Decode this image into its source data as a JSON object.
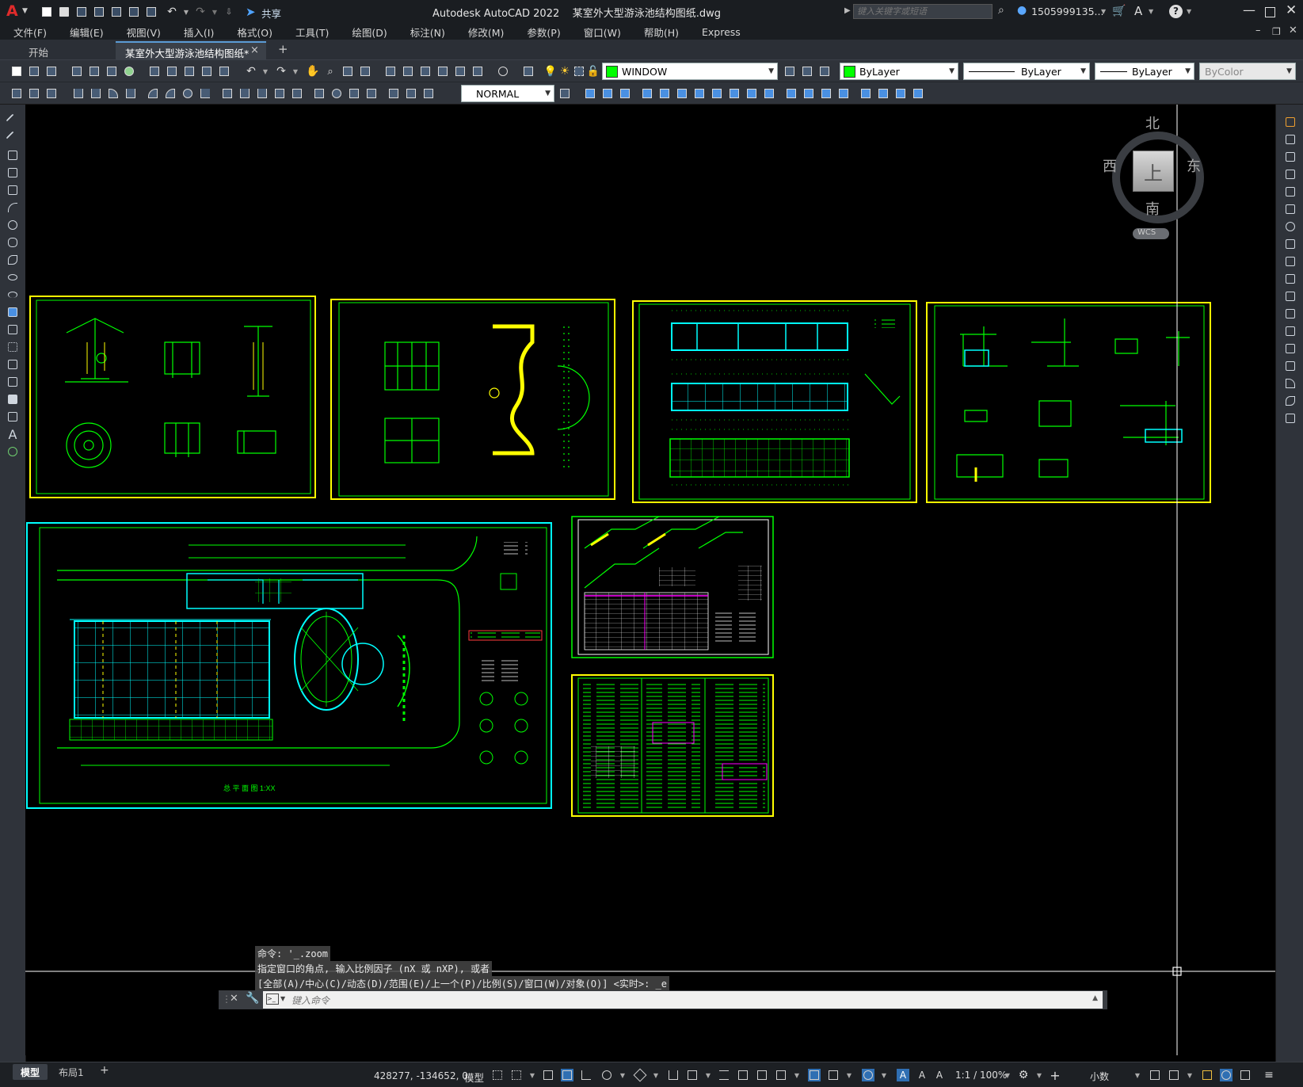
{
  "title": {
    "app_logo": "A",
    "share_label": "共享",
    "window_title": "Autodesk AutoCAD 2022    某室外大型游泳池结构图纸.dwg",
    "search_placeholder": "键入关键字或短语",
    "user": "1505999135...",
    "help": "?"
  },
  "menu": [
    "文件(F)",
    "编辑(E)",
    "视图(V)",
    "插入(I)",
    "格式(O)",
    "工具(T)",
    "绘图(D)",
    "标注(N)",
    "修改(M)",
    "参数(P)",
    "窗口(W)",
    "帮助(H)",
    "Express"
  ],
  "tabs": {
    "start": "开始",
    "active": "某室外大型游泳池结构图纸*",
    "close": "×",
    "add": "+"
  },
  "toolbar": {
    "layer_state": "WINDOW",
    "color": "ByLayer",
    "linetype": "ByLayer",
    "lineweight": "ByLayer",
    "plotstyle": "ByColor",
    "style": "NORMAL"
  },
  "viewcube": {
    "north": "北",
    "south": "南",
    "east": "东",
    "west": "西",
    "top": "上",
    "wcs": "WCS"
  },
  "command": {
    "line1": "命令: '_.zoom",
    "line2": "指定窗口的角点, 输入比例因子 (nX 或 nXP), 或者",
    "line3": "[全部(A)/中心(C)/动态(D)/范围(E)/上一个(P)/比例(S)/窗口(W)/对象(O)] <实时>: _e",
    "placeholder": "键入命令"
  },
  "layout_tabs": {
    "model": "模型",
    "layout1": "布局1",
    "add": "+"
  },
  "status": {
    "coords": "428277, -134652, 0",
    "model": "模型",
    "scale": "1:1 / 100%",
    "units": "小数"
  },
  "colors": {
    "yellow": "#ffff00",
    "green": "#00ff00",
    "cyan": "#00ffff",
    "white": "#ffffff",
    "bg": "#000000",
    "layer_swatch": "#00ff00"
  },
  "drawing_labels": {
    "site_plan": "总 平 面 图 1:XX"
  }
}
